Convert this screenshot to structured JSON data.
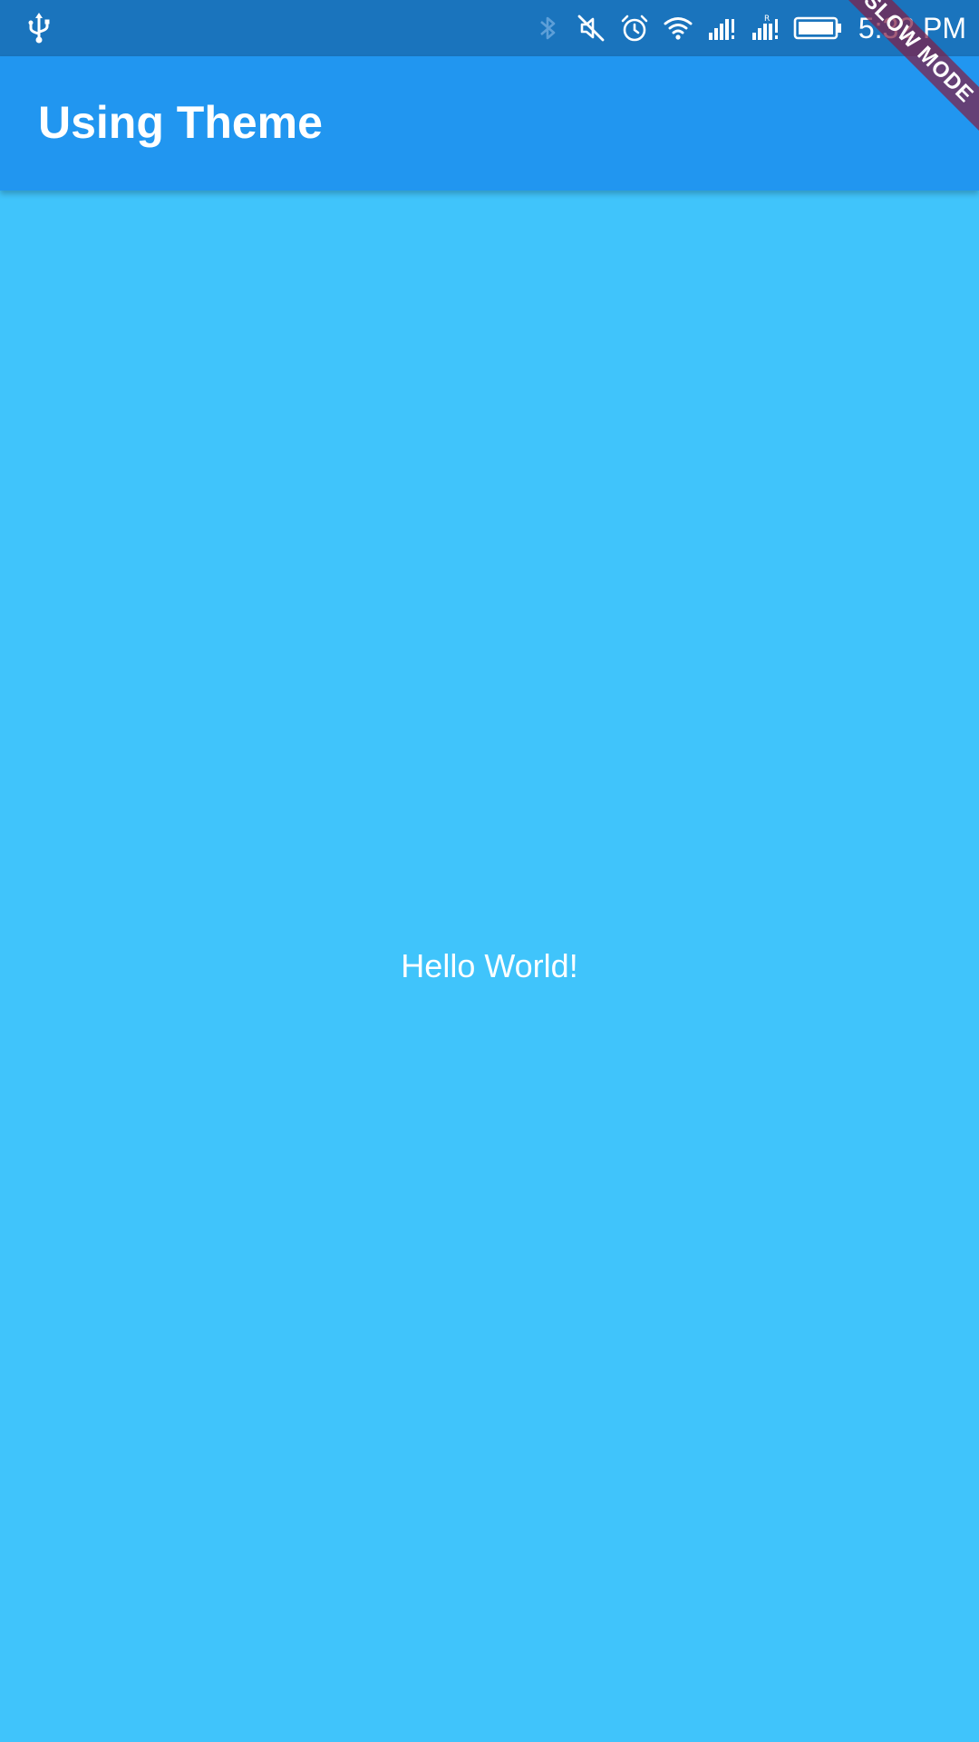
{
  "status_bar": {
    "time": "5:32 PM",
    "icons": [
      "usb-icon",
      "bluetooth-icon",
      "mute-icon",
      "alarm-icon",
      "wifi-icon",
      "signal-icon",
      "signal-roaming-icon",
      "battery-icon"
    ],
    "background": "#1a74bd"
  },
  "app_bar": {
    "title": "Using Theme",
    "background": "#2196f0"
  },
  "body": {
    "message": "Hello World!",
    "background": "#40c4fb"
  },
  "debug_banner": {
    "label": "SLOW MODE"
  }
}
